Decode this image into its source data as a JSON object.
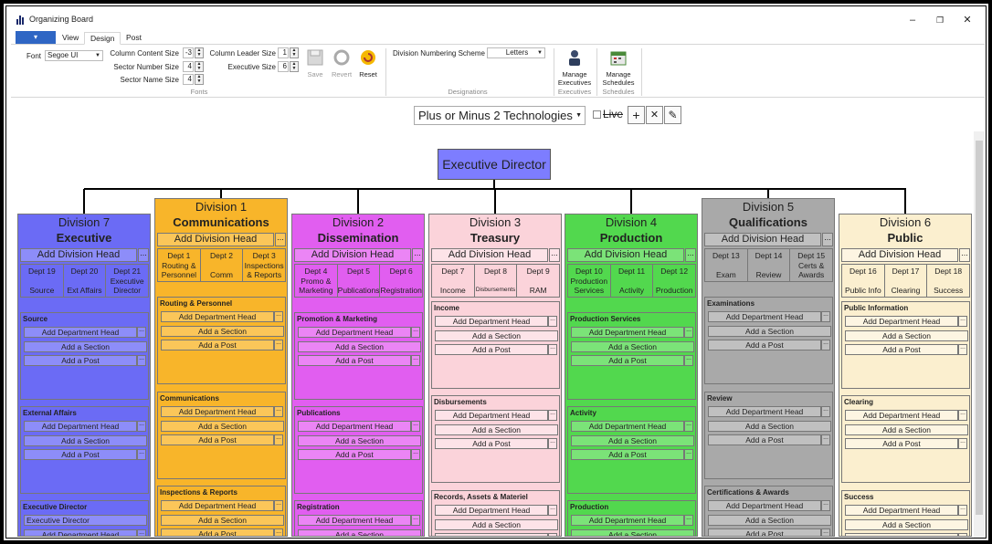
{
  "window": {
    "title": "Organizing Board"
  },
  "ribbon": {
    "tabs": [
      "View",
      "Design",
      "Post"
    ],
    "font_label": "Font",
    "font_value": "Segoe UI",
    "col_content_label": "Column Content Size",
    "col_content_value": "-3",
    "sector_num_label": "Sector Number Size",
    "sector_num_value": "4",
    "sector_name_label": "Sector Name Size",
    "sector_name_value": "4",
    "col_leader_label": "Column Leader Size",
    "col_leader_value": "1",
    "exec_size_label": "Executive Size",
    "exec_size_value": "6",
    "save": "Save",
    "revert": "Revert",
    "reset": "Reset",
    "fonts_group": "Fonts",
    "numbering_label": "Division Numbering Scheme",
    "numbering_value": "Letters",
    "designations_group": "Designations",
    "manage_exec": [
      "Manage",
      "Executives"
    ],
    "executives_group": "Executives",
    "manage_sched": [
      "Manage",
      "Schedules"
    ],
    "schedules_group": "Schedules"
  },
  "toolbar": {
    "board": "Plus or Minus 2 Technologies",
    "live": "Live",
    "add": "+",
    "remove": "✕",
    "edit": "✎"
  },
  "board": {
    "executive": "Executive Director",
    "add_div_head": "Add Division Head",
    "add_dept_head": "Add Department Head",
    "add_section": "Add a Section",
    "add_post": "Add a Post",
    "dots": "...",
    "divisions": [
      {
        "num": "Division 7",
        "name": "Executive",
        "color": "#6b6bf5",
        "light": "#8d8df9",
        "depts": [
          {
            "n": "Dept 19",
            "nm": "Source"
          },
          {
            "n": "Dept 20",
            "nm": "Ext Affairs"
          },
          {
            "n": "Dept 21",
            "nm": "Executive Director"
          }
        ],
        "boxes": [
          {
            "t": "Source"
          },
          {
            "t": "External Affairs"
          },
          {
            "t": "Executive Director",
            "extra": "Executive Director"
          }
        ]
      },
      {
        "num": "Division 1",
        "name": "Communications",
        "color": "#f8b52a",
        "light": "#fbc659",
        "depts": [
          {
            "n": "Dept 1",
            "nm": "Routing & Personnel"
          },
          {
            "n": "Dept 2",
            "nm": "Comm"
          },
          {
            "n": "Dept 3",
            "nm": "Inspections & Reports"
          }
        ],
        "boxes": [
          {
            "t": "Routing & Personnel"
          },
          {
            "t": "Communications"
          },
          {
            "t": "Inspections & Reports"
          }
        ]
      },
      {
        "num": "Division 2",
        "name": "Dissemination",
        "color": "#e15ef0",
        "light": "#eb85f5",
        "depts": [
          {
            "n": "Dept 4",
            "nm": "Promo & Marketing"
          },
          {
            "n": "Dept 5",
            "nm": "Publications"
          },
          {
            "n": "Dept 6",
            "nm": "Registration"
          }
        ],
        "boxes": [
          {
            "t": "Promotion & Marketing"
          },
          {
            "t": "Publications"
          },
          {
            "t": "Registration"
          }
        ]
      },
      {
        "num": "Division 3",
        "name": "Treasury",
        "color": "#fbd3da",
        "light": "#fde3e8",
        "depts": [
          {
            "n": "Dept 7",
            "nm": "Income"
          },
          {
            "n": "Dept 8",
            "nm": "Disbursements"
          },
          {
            "n": "Dept 9",
            "nm": "RAM"
          }
        ],
        "boxes": [
          {
            "t": "Income"
          },
          {
            "t": "Disbursements"
          },
          {
            "t": "Records, Assets & Materiel"
          }
        ]
      },
      {
        "num": "Division 4",
        "name": "Production",
        "color": "#52d84e",
        "light": "#7be378",
        "depts": [
          {
            "n": "Dept 10",
            "nm": "Production Services"
          },
          {
            "n": "Dept 11",
            "nm": "Activity"
          },
          {
            "n": "Dept 12",
            "nm": "Production"
          }
        ],
        "boxes": [
          {
            "t": "Production Services"
          },
          {
            "t": "Activity"
          },
          {
            "t": "Production"
          }
        ]
      },
      {
        "num": "Division 5",
        "name": "Qualifications",
        "color": "#a9a9a9",
        "light": "#c0c0c0",
        "depts": [
          {
            "n": "Dept 13",
            "nm": "Exam"
          },
          {
            "n": "Dept 14",
            "nm": "Review"
          },
          {
            "n": "Dept 15",
            "nm": "Certs & Awards"
          }
        ],
        "boxes": [
          {
            "t": "Examinations"
          },
          {
            "t": "Review"
          },
          {
            "t": "Certifications & Awards"
          }
        ]
      },
      {
        "num": "Division 6",
        "name": "Public",
        "color": "#fbefcf",
        "light": "#fdf5e2",
        "depts": [
          {
            "n": "Dept 16",
            "nm": "Public Info"
          },
          {
            "n": "Dept 17",
            "nm": "Clearing"
          },
          {
            "n": "Dept 18",
            "nm": "Success"
          }
        ],
        "boxes": [
          {
            "t": "Public Information"
          },
          {
            "t": "Clearing"
          },
          {
            "t": "Success"
          }
        ]
      }
    ]
  }
}
